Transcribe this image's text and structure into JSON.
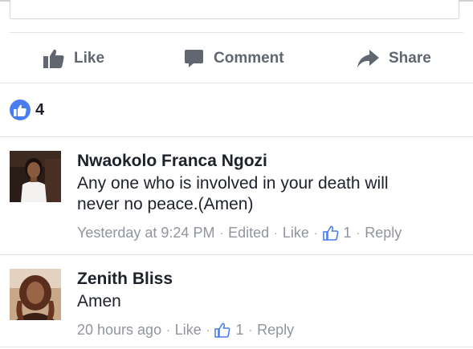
{
  "actions": {
    "like_label": "Like",
    "comment_label": "Comment",
    "share_label": "Share"
  },
  "reactions": {
    "count": "4"
  },
  "colors": {
    "action_gray": "#606770",
    "meta_gray": "#90949c",
    "like_blue": "#4a7ef0"
  },
  "comments": [
    {
      "name": "Nwaokolo Franca Ngozi",
      "text_line1": "Any one who is involved in your death will",
      "text_line2": "never no peace.(Amen)",
      "time": "Yesterday at 9:24 PM",
      "edited": "Edited",
      "like": "Like",
      "like_count": "1",
      "reply": "Reply",
      "separator": "·"
    },
    {
      "name": "Zenith Bliss",
      "text_line1": "Amen",
      "time": "20 hours ago",
      "like": "Like",
      "like_count": "1",
      "reply": "Reply",
      "separator": "·"
    }
  ]
}
